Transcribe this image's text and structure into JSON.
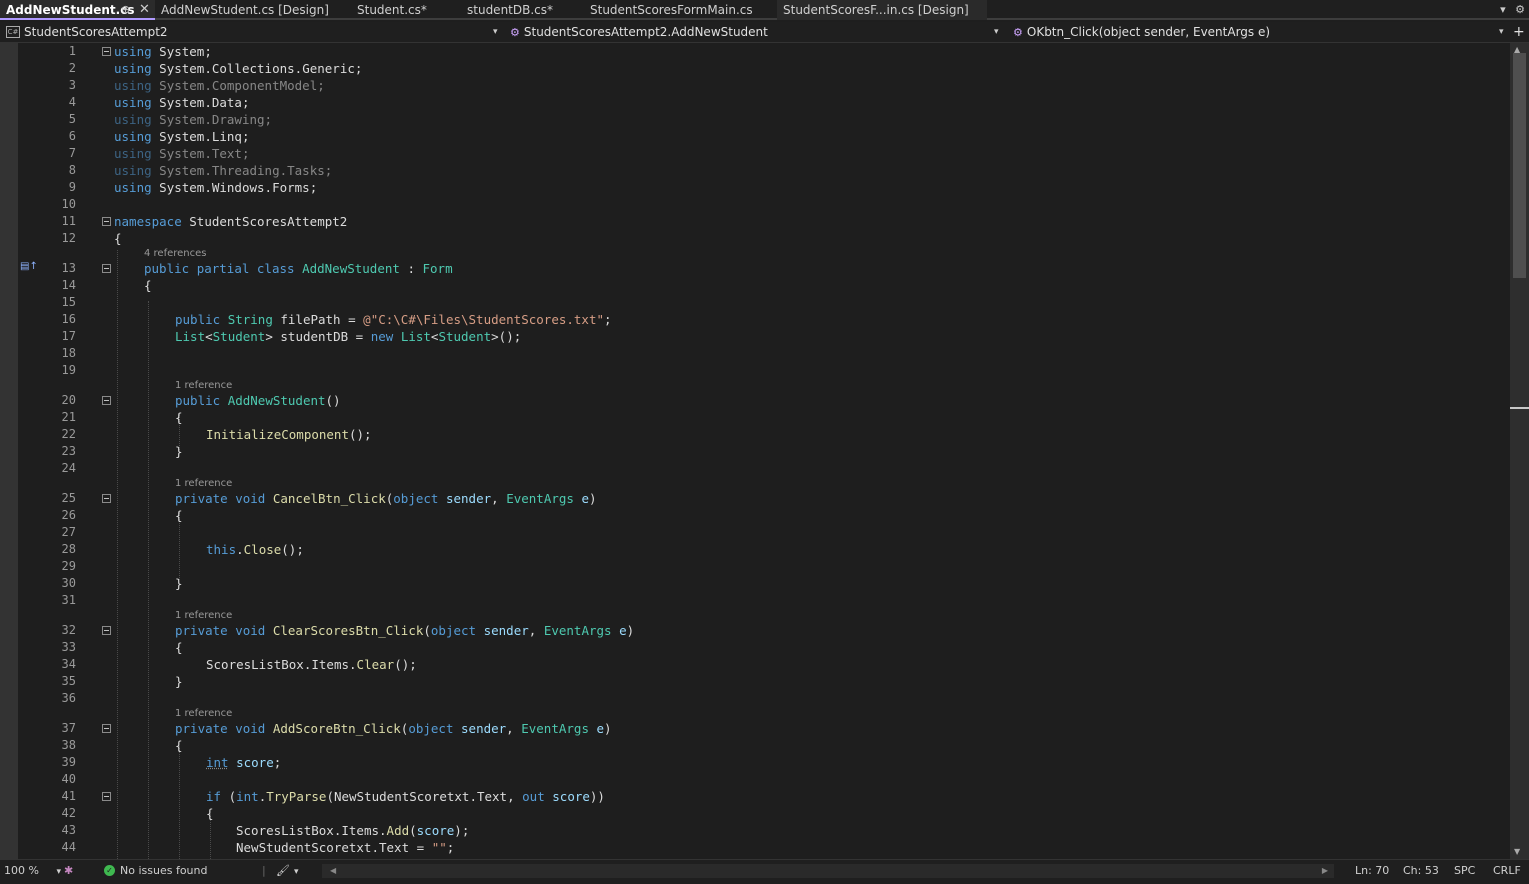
{
  "tabs": [
    {
      "label": "AddNewStudent.cs",
      "active": true,
      "pin": "⊕",
      "close": "✕"
    },
    {
      "label": "AddNewStudent.cs [Design]"
    },
    {
      "label": "Student.cs*"
    },
    {
      "label": "studentDB.cs*"
    },
    {
      "label": "StudentScoresFormMain.cs"
    },
    {
      "label": "StudentScoresF...in.cs [Design]"
    }
  ],
  "tabbar_icons": {
    "overflow": "▾",
    "settings": "⚙"
  },
  "nav": {
    "project": "StudentScoresAttempt2",
    "class": "StudentScoresAttempt2.AddNewStudent",
    "member": "OKbtn_Click(object sender, EventArgs e)",
    "project_icon": "C#",
    "split": "+"
  },
  "code_lens": {
    "l13": "4 references",
    "l20": "1 reference",
    "l25": "1 reference",
    "l32": "1 reference",
    "l37": "1 reference"
  },
  "line_numbers": [
    "1",
    "2",
    "3",
    "4",
    "5",
    "6",
    "7",
    "8",
    "9",
    "10",
    "11",
    "12",
    "13",
    "14",
    "15",
    "16",
    "17",
    "18",
    "19",
    "20",
    "21",
    "22",
    "23",
    "24",
    "25",
    "26",
    "27",
    "28",
    "29",
    "30",
    "31",
    "32",
    "33",
    "34",
    "35",
    "36",
    "37",
    "38",
    "39",
    "40",
    "41",
    "42",
    "43",
    "44"
  ],
  "code": {
    "l1": [
      "using",
      "System",
      ";"
    ],
    "l2": [
      "using",
      "System",
      ".",
      "Collections",
      ".",
      "Generic",
      ";"
    ],
    "l3": [
      "using",
      "System",
      ".",
      "ComponentModel",
      ";"
    ],
    "l4": [
      "using",
      "System",
      ".",
      "Data",
      ";"
    ],
    "l5": [
      "using",
      "System",
      ".",
      "Drawing",
      ";"
    ],
    "l6": [
      "using",
      "System",
      ".",
      "Linq",
      ";"
    ],
    "l7": [
      "using",
      "System",
      ".",
      "Text",
      ";"
    ],
    "l8": [
      "using",
      "System",
      ".",
      "Threading",
      ".",
      "Tasks",
      ";"
    ],
    "l9": [
      "using",
      "System",
      ".",
      "Windows",
      ".",
      "Forms",
      ";"
    ],
    "l11": [
      "namespace",
      "StudentScoresAttempt2"
    ],
    "l12": [
      "{"
    ],
    "l13": [
      "public",
      "partial",
      "class",
      "AddNewStudent",
      " : ",
      "Form"
    ],
    "l14": [
      "{"
    ],
    "l16": [
      "public",
      "String",
      "filePath",
      " = ",
      "@\"C:\\C#\\Files\\StudentScores.txt\"",
      ";"
    ],
    "l17": [
      "List",
      "<",
      "Student",
      ">",
      "studentDB",
      " = ",
      "new",
      "List",
      "<",
      "Student",
      ">();"
    ],
    "l20": [
      "public",
      "AddNewStudent",
      "()"
    ],
    "l21": [
      "{"
    ],
    "l22": [
      "InitializeComponent",
      "();"
    ],
    "l23": [
      "}"
    ],
    "l25": [
      "private",
      "void",
      "CancelBtn_Click",
      "(",
      "object",
      "sender",
      ", ",
      "EventArgs",
      "e",
      ")"
    ],
    "l26": [
      "{"
    ],
    "l28": [
      "this",
      ".",
      "Close",
      "();"
    ],
    "l30": [
      "}"
    ],
    "l32": [
      "private",
      "void",
      "ClearScoresBtn_Click",
      "(",
      "object",
      "sender",
      ", ",
      "EventArgs",
      "e",
      ")"
    ],
    "l33": [
      "{"
    ],
    "l34": [
      "ScoresListBox",
      ".",
      "Items",
      ".",
      "Clear",
      "();"
    ],
    "l35": [
      "}"
    ],
    "l37": [
      "private",
      "void",
      "AddScoreBtn_Click",
      "(",
      "object",
      "sender",
      ", ",
      "EventArgs",
      "e",
      ")"
    ],
    "l38": [
      "{"
    ],
    "l39": [
      "int",
      "score",
      ";"
    ],
    "l41": [
      "if",
      " (",
      "int",
      ".",
      "TryParse",
      "(",
      "NewStudentScoretxt",
      ".",
      "Text",
      ", ",
      "out",
      "score",
      "))"
    ],
    "l42": [
      "{"
    ],
    "l43": [
      "ScoresListBox",
      ".",
      "Items",
      ".",
      "Add",
      "(",
      "score",
      ");"
    ],
    "l44": [
      "NewStudentScoretxt",
      ".",
      "Text",
      " = ",
      "\"\"",
      ";"
    ]
  },
  "status": {
    "zoom": "100 %",
    "issues": "No issues found",
    "ln": "Ln: 70",
    "ch": "Ch: 53",
    "spc": "SPC",
    "eol": "CRLF",
    "check": "✓",
    "dropdown": "▾",
    "left_arrow": "◀",
    "right_arrow": "▶"
  },
  "colors": {
    "keyword": "#569cd6",
    "type": "#4ec9b0",
    "method": "#dcdcaa",
    "string": "#d69d85",
    "variable": "#9cdcfe",
    "text": "#dcdcdc",
    "active_tab_accent": "#b09aff",
    "ok": "#3fb950"
  }
}
